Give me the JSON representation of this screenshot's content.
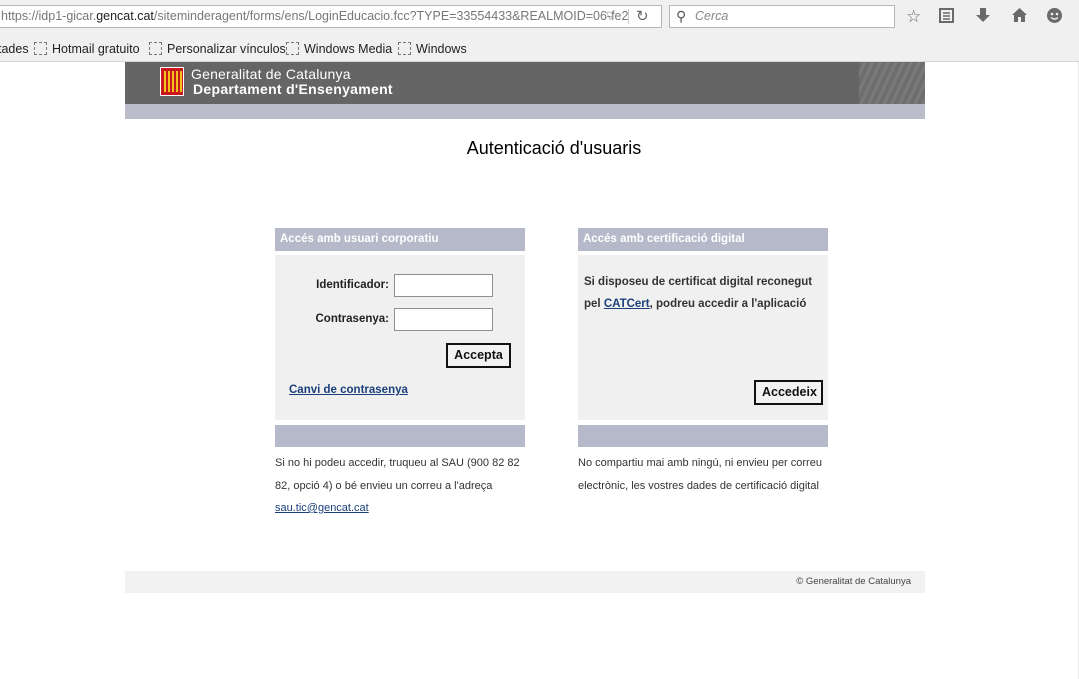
{
  "browser": {
    "url_prefix": "https://idp1-gicar.",
    "url_domain": "gencat.cat",
    "url_suffix": "/siteminderagent/forms/ens/LoginEducacio.fcc?TYPE=33554433&REALMOID=06-fe2",
    "search_placeholder": "Cerca",
    "bookmarks": [
      {
        "label": "tades"
      },
      {
        "label": "Hotmail gratuito"
      },
      {
        "label": "Personalizar vínculos"
      },
      {
        "label": "Windows Media"
      },
      {
        "label": "Windows"
      }
    ],
    "icons": [
      "dropdown-arrow-icon",
      "reload-icon",
      "search-icon",
      "star-icon",
      "reading-list-icon",
      "download-icon",
      "home-icon",
      "smiley-icon"
    ]
  },
  "header": {
    "line1": "Generalitat de Catalunya",
    "line2": "Departament d'Ensenyament"
  },
  "page": {
    "title": "Autenticació d'usuaris"
  },
  "login_box": {
    "heading": "Accés amb usuari corporatiu",
    "id_label": "Identificador:",
    "id_value": "",
    "password_label": "Contrasenya:",
    "password_value": "",
    "submit_label": "Accepta",
    "change_password_link": "Canvi de contrasenya",
    "note_text": "Si no hi podeu accedir, truqueu al SAU (900 82 82 82, opció 4) o bé envieu un correu a l'adreça",
    "note_email": "sau.tic@gencat.cat"
  },
  "cert_box": {
    "heading": "Accés amb certificació digital",
    "text_before": "Si disposeu de certificat digital reconegut pel",
    "link": "CATCert",
    "text_after": ", podreu accedir a l'aplicació",
    "submit_label": "Accedeix",
    "note_text": "No compartiu mai amb ningú, ni envieu per correu electrònic, les vostres dades de certificació digital"
  },
  "footer": {
    "copyright": "© Generalitat de Catalunya"
  },
  "colors": {
    "header_bg": "#656565",
    "band": "#bbbdcb",
    "box_head": "#b5b9c9",
    "box_body": "#f0f0f0",
    "link": "#1a3f7a",
    "logo_red": "#c8181e",
    "logo_gold": "#f4c31a"
  }
}
